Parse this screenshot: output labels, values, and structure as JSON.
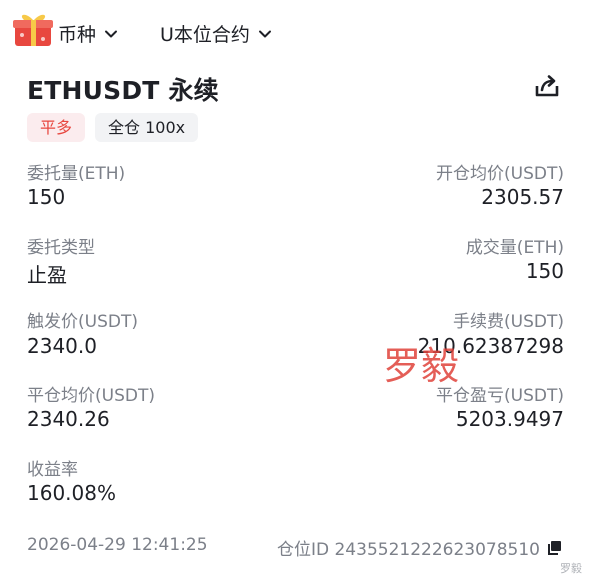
{
  "header": {
    "selector_all_coins": "币种",
    "selector_contract_type": "U本位合约",
    "gift_icon": "gift-icon"
  },
  "order": {
    "symbol_title": "ETHUSDT 永续",
    "direction_tag": "平多",
    "margin_tag": "全仓 100x",
    "share_icon": "share-icon"
  },
  "fields": {
    "order_qty_label": "委托量(ETH)",
    "order_qty_value": "150",
    "avg_open_label": "开仓均价(USDT)",
    "avg_open_value": "2305.57",
    "order_type_label": "委托类型",
    "order_type_value": "止盈",
    "filled_qty_label": "成交量(ETH)",
    "filled_qty_value": "150",
    "trigger_label": "触发价(USDT)",
    "trigger_value": "2340.0",
    "fee_label": "手续费(USDT)",
    "fee_value": "210.62387298",
    "avg_close_label": "平仓均价(USDT)",
    "avg_close_value": "2340.26",
    "pnl_label": "平仓盈亏(USDT)",
    "pnl_value": "5203.9497",
    "roi_label": "收益率",
    "roi_value": "160.08%"
  },
  "watermark": "罗毅",
  "footer": {
    "timestamp": "2026-04-29 12:41:25",
    "position_id": "仓位ID 2435521222623078510",
    "copy_icon": "copy-icon",
    "credit": "罗毅"
  },
  "colors": {
    "accent_red": "#e8473f",
    "tag_red_bg": "#fbecee",
    "tag_gray_bg": "#f2f3f5",
    "label_gray": "#7c8089",
    "text_dark": "#1e2026"
  }
}
